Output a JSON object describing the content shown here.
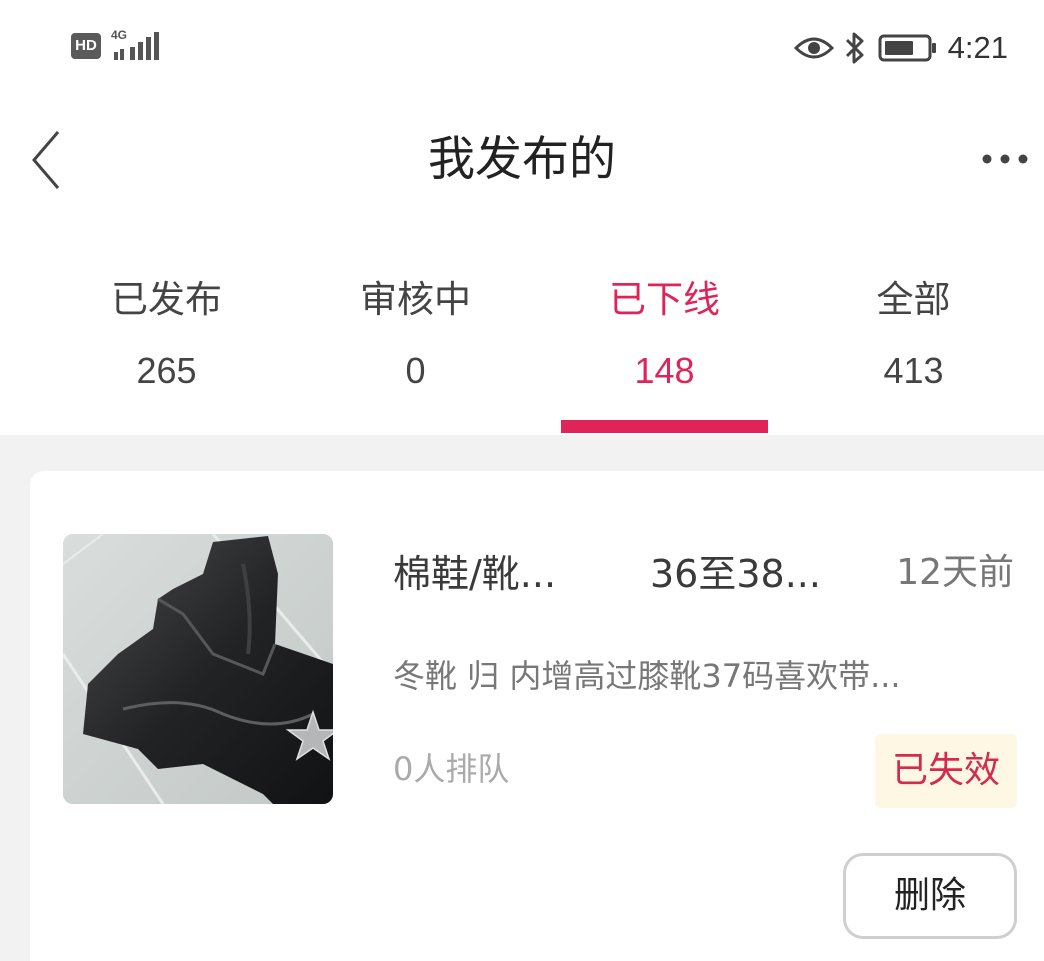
{
  "status_bar": {
    "hd_label": "HD",
    "network_label": "4G",
    "time": "4:21",
    "icons": [
      "eye-icon",
      "bluetooth-icon",
      "battery-icon"
    ]
  },
  "header": {
    "title": "我发布的",
    "back_icon": "chevron-left-icon",
    "more_icon": "more-horizontal-icon"
  },
  "tabs": [
    {
      "label": "已发布",
      "count": "265",
      "active": false
    },
    {
      "label": "审核中",
      "count": "0",
      "active": false
    },
    {
      "label": "已下线",
      "count": "148",
      "active": true
    },
    {
      "label": "全部",
      "count": "413",
      "active": false
    }
  ],
  "colors": {
    "accent": "#e0245a",
    "background": "#f2f2f2",
    "badge_bg": "#fdf7e4",
    "badge_text": "#d42a50"
  },
  "items": [
    {
      "category": "棉鞋/靴...",
      "size": "36至38...",
      "time": "12天前",
      "description": "冬靴 归 内增高过膝靴37码喜欢带...",
      "queue": "0人排队",
      "status": "已失效",
      "delete_label": "删除"
    }
  ]
}
